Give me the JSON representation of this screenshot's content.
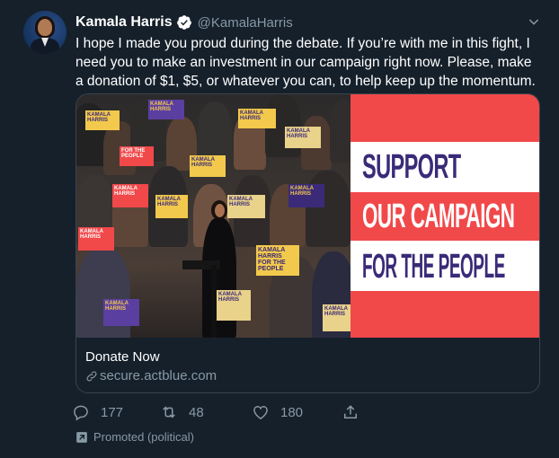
{
  "tweet": {
    "author_name": "Kamala Harris",
    "author_handle": "@KamalaHarris",
    "text": "I hope I made you proud during the debate. If you’re with me in this fight, I need you to make an investment in our campaign right now. Please, make a donation of $1, $5, or whatever you can, to help keep up the momentum.",
    "verified": true
  },
  "card": {
    "banner_lines": [
      "SUPPORT",
      "OUR CAMPAIGN",
      "FOR THE PEOPLE"
    ],
    "title": "Donate Now",
    "url": "secure.actblue.com",
    "sign_text": [
      "KAMALA",
      "HARRIS",
      "FOR THE",
      "PEOPLE"
    ]
  },
  "actions": {
    "replies": "177",
    "retweets": "48",
    "likes": "180"
  },
  "promoted_label": "Promoted (political)",
  "icons": {
    "verified": "verified-badge-icon",
    "caret": "chevron-down-icon",
    "link": "link-icon",
    "reply": "reply-icon",
    "retweet": "retweet-icon",
    "like": "heart-icon",
    "share": "share-icon",
    "promoted": "promoted-icon"
  },
  "colors": {
    "background": "#15202b",
    "secondary_text": "#8899a6",
    "border": "#38444d",
    "banner_red": "#f1484a",
    "banner_purple": "#3b2a78",
    "verified_blue": "#1da1f2",
    "sign_yellow": "#f2c94c"
  }
}
